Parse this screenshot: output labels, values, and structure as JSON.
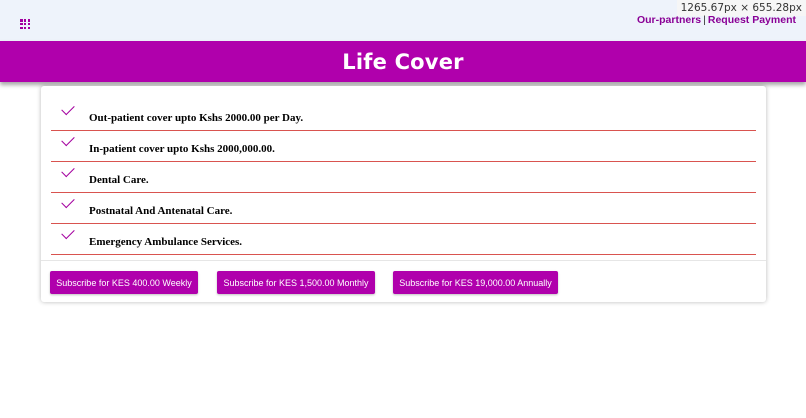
{
  "header": {
    "dimensions_readout": "1265.67px × 655.28px",
    "links": [
      {
        "label": "Our-partners"
      },
      {
        "label": "Request Payment"
      }
    ],
    "separator": "|"
  },
  "banner": {
    "title": "Life Cover"
  },
  "features": [
    {
      "text": "Out-patient cover upto Kshs 2000.00 per Day."
    },
    {
      "text": "In-patient cover upto Kshs 2000,000.00."
    },
    {
      "text": "Dental Care."
    },
    {
      "text": "Postnatal And Antenatal Care."
    },
    {
      "text": "Emergency Ambulance Services."
    }
  ],
  "subscribe": [
    {
      "label": "Subscribe for KES 400.00 Weekly"
    },
    {
      "label": "Subscribe for KES 1,500.00 Monthly"
    },
    {
      "label": "Subscribe for KES 19,000.00 Annually"
    }
  ],
  "colors": {
    "brand": "#b000ac",
    "divider": "#d9534f",
    "topbar": "#eef3fb"
  },
  "icons": {
    "menu": "apps-grid-icon",
    "feature": "check-icon"
  }
}
